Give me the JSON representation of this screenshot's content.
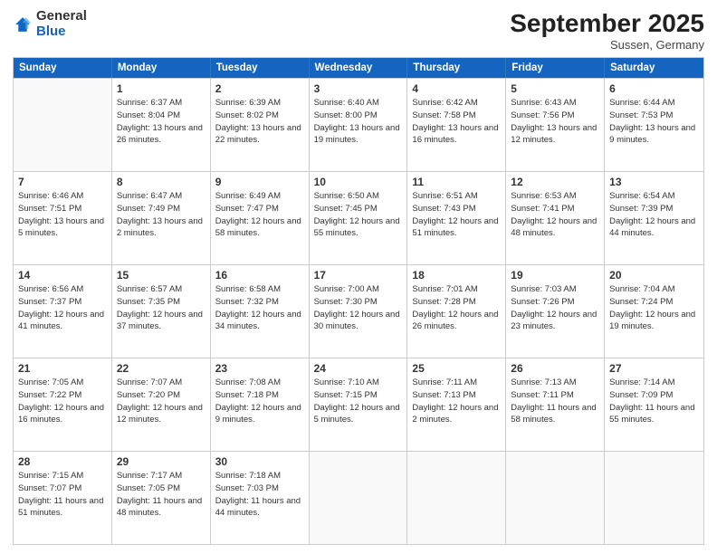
{
  "logo": {
    "general": "General",
    "blue": "Blue"
  },
  "header": {
    "month": "September 2025",
    "location": "Sussen, Germany"
  },
  "days_of_week": [
    "Sunday",
    "Monday",
    "Tuesday",
    "Wednesday",
    "Thursday",
    "Friday",
    "Saturday"
  ],
  "weeks": [
    [
      {
        "day": null,
        "sunrise": null,
        "sunset": null,
        "daylight": null
      },
      {
        "day": "1",
        "sunrise": "Sunrise: 6:37 AM",
        "sunset": "Sunset: 8:04 PM",
        "daylight": "Daylight: 13 hours and 26 minutes."
      },
      {
        "day": "2",
        "sunrise": "Sunrise: 6:39 AM",
        "sunset": "Sunset: 8:02 PM",
        "daylight": "Daylight: 13 hours and 22 minutes."
      },
      {
        "day": "3",
        "sunrise": "Sunrise: 6:40 AM",
        "sunset": "Sunset: 8:00 PM",
        "daylight": "Daylight: 13 hours and 19 minutes."
      },
      {
        "day": "4",
        "sunrise": "Sunrise: 6:42 AM",
        "sunset": "Sunset: 7:58 PM",
        "daylight": "Daylight: 13 hours and 16 minutes."
      },
      {
        "day": "5",
        "sunrise": "Sunrise: 6:43 AM",
        "sunset": "Sunset: 7:56 PM",
        "daylight": "Daylight: 13 hours and 12 minutes."
      },
      {
        "day": "6",
        "sunrise": "Sunrise: 6:44 AM",
        "sunset": "Sunset: 7:53 PM",
        "daylight": "Daylight: 13 hours and 9 minutes."
      }
    ],
    [
      {
        "day": "7",
        "sunrise": "Sunrise: 6:46 AM",
        "sunset": "Sunset: 7:51 PM",
        "daylight": "Daylight: 13 hours and 5 minutes."
      },
      {
        "day": "8",
        "sunrise": "Sunrise: 6:47 AM",
        "sunset": "Sunset: 7:49 PM",
        "daylight": "Daylight: 13 hours and 2 minutes."
      },
      {
        "day": "9",
        "sunrise": "Sunrise: 6:49 AM",
        "sunset": "Sunset: 7:47 PM",
        "daylight": "Daylight: 12 hours and 58 minutes."
      },
      {
        "day": "10",
        "sunrise": "Sunrise: 6:50 AM",
        "sunset": "Sunset: 7:45 PM",
        "daylight": "Daylight: 12 hours and 55 minutes."
      },
      {
        "day": "11",
        "sunrise": "Sunrise: 6:51 AM",
        "sunset": "Sunset: 7:43 PM",
        "daylight": "Daylight: 12 hours and 51 minutes."
      },
      {
        "day": "12",
        "sunrise": "Sunrise: 6:53 AM",
        "sunset": "Sunset: 7:41 PM",
        "daylight": "Daylight: 12 hours and 48 minutes."
      },
      {
        "day": "13",
        "sunrise": "Sunrise: 6:54 AM",
        "sunset": "Sunset: 7:39 PM",
        "daylight": "Daylight: 12 hours and 44 minutes."
      }
    ],
    [
      {
        "day": "14",
        "sunrise": "Sunrise: 6:56 AM",
        "sunset": "Sunset: 7:37 PM",
        "daylight": "Daylight: 12 hours and 41 minutes."
      },
      {
        "day": "15",
        "sunrise": "Sunrise: 6:57 AM",
        "sunset": "Sunset: 7:35 PM",
        "daylight": "Daylight: 12 hours and 37 minutes."
      },
      {
        "day": "16",
        "sunrise": "Sunrise: 6:58 AM",
        "sunset": "Sunset: 7:32 PM",
        "daylight": "Daylight: 12 hours and 34 minutes."
      },
      {
        "day": "17",
        "sunrise": "Sunrise: 7:00 AM",
        "sunset": "Sunset: 7:30 PM",
        "daylight": "Daylight: 12 hours and 30 minutes."
      },
      {
        "day": "18",
        "sunrise": "Sunrise: 7:01 AM",
        "sunset": "Sunset: 7:28 PM",
        "daylight": "Daylight: 12 hours and 26 minutes."
      },
      {
        "day": "19",
        "sunrise": "Sunrise: 7:03 AM",
        "sunset": "Sunset: 7:26 PM",
        "daylight": "Daylight: 12 hours and 23 minutes."
      },
      {
        "day": "20",
        "sunrise": "Sunrise: 7:04 AM",
        "sunset": "Sunset: 7:24 PM",
        "daylight": "Daylight: 12 hours and 19 minutes."
      }
    ],
    [
      {
        "day": "21",
        "sunrise": "Sunrise: 7:05 AM",
        "sunset": "Sunset: 7:22 PM",
        "daylight": "Daylight: 12 hours and 16 minutes."
      },
      {
        "day": "22",
        "sunrise": "Sunrise: 7:07 AM",
        "sunset": "Sunset: 7:20 PM",
        "daylight": "Daylight: 12 hours and 12 minutes."
      },
      {
        "day": "23",
        "sunrise": "Sunrise: 7:08 AM",
        "sunset": "Sunset: 7:18 PM",
        "daylight": "Daylight: 12 hours and 9 minutes."
      },
      {
        "day": "24",
        "sunrise": "Sunrise: 7:10 AM",
        "sunset": "Sunset: 7:15 PM",
        "daylight": "Daylight: 12 hours and 5 minutes."
      },
      {
        "day": "25",
        "sunrise": "Sunrise: 7:11 AM",
        "sunset": "Sunset: 7:13 PM",
        "daylight": "Daylight: 12 hours and 2 minutes."
      },
      {
        "day": "26",
        "sunrise": "Sunrise: 7:13 AM",
        "sunset": "Sunset: 7:11 PM",
        "daylight": "Daylight: 11 hours and 58 minutes."
      },
      {
        "day": "27",
        "sunrise": "Sunrise: 7:14 AM",
        "sunset": "Sunset: 7:09 PM",
        "daylight": "Daylight: 11 hours and 55 minutes."
      }
    ],
    [
      {
        "day": "28",
        "sunrise": "Sunrise: 7:15 AM",
        "sunset": "Sunset: 7:07 PM",
        "daylight": "Daylight: 11 hours and 51 minutes."
      },
      {
        "day": "29",
        "sunrise": "Sunrise: 7:17 AM",
        "sunset": "Sunset: 7:05 PM",
        "daylight": "Daylight: 11 hours and 48 minutes."
      },
      {
        "day": "30",
        "sunrise": "Sunrise: 7:18 AM",
        "sunset": "Sunset: 7:03 PM",
        "daylight": "Daylight: 11 hours and 44 minutes."
      },
      {
        "day": null,
        "sunrise": null,
        "sunset": null,
        "daylight": null
      },
      {
        "day": null,
        "sunrise": null,
        "sunset": null,
        "daylight": null
      },
      {
        "day": null,
        "sunrise": null,
        "sunset": null,
        "daylight": null
      },
      {
        "day": null,
        "sunrise": null,
        "sunset": null,
        "daylight": null
      }
    ]
  ]
}
